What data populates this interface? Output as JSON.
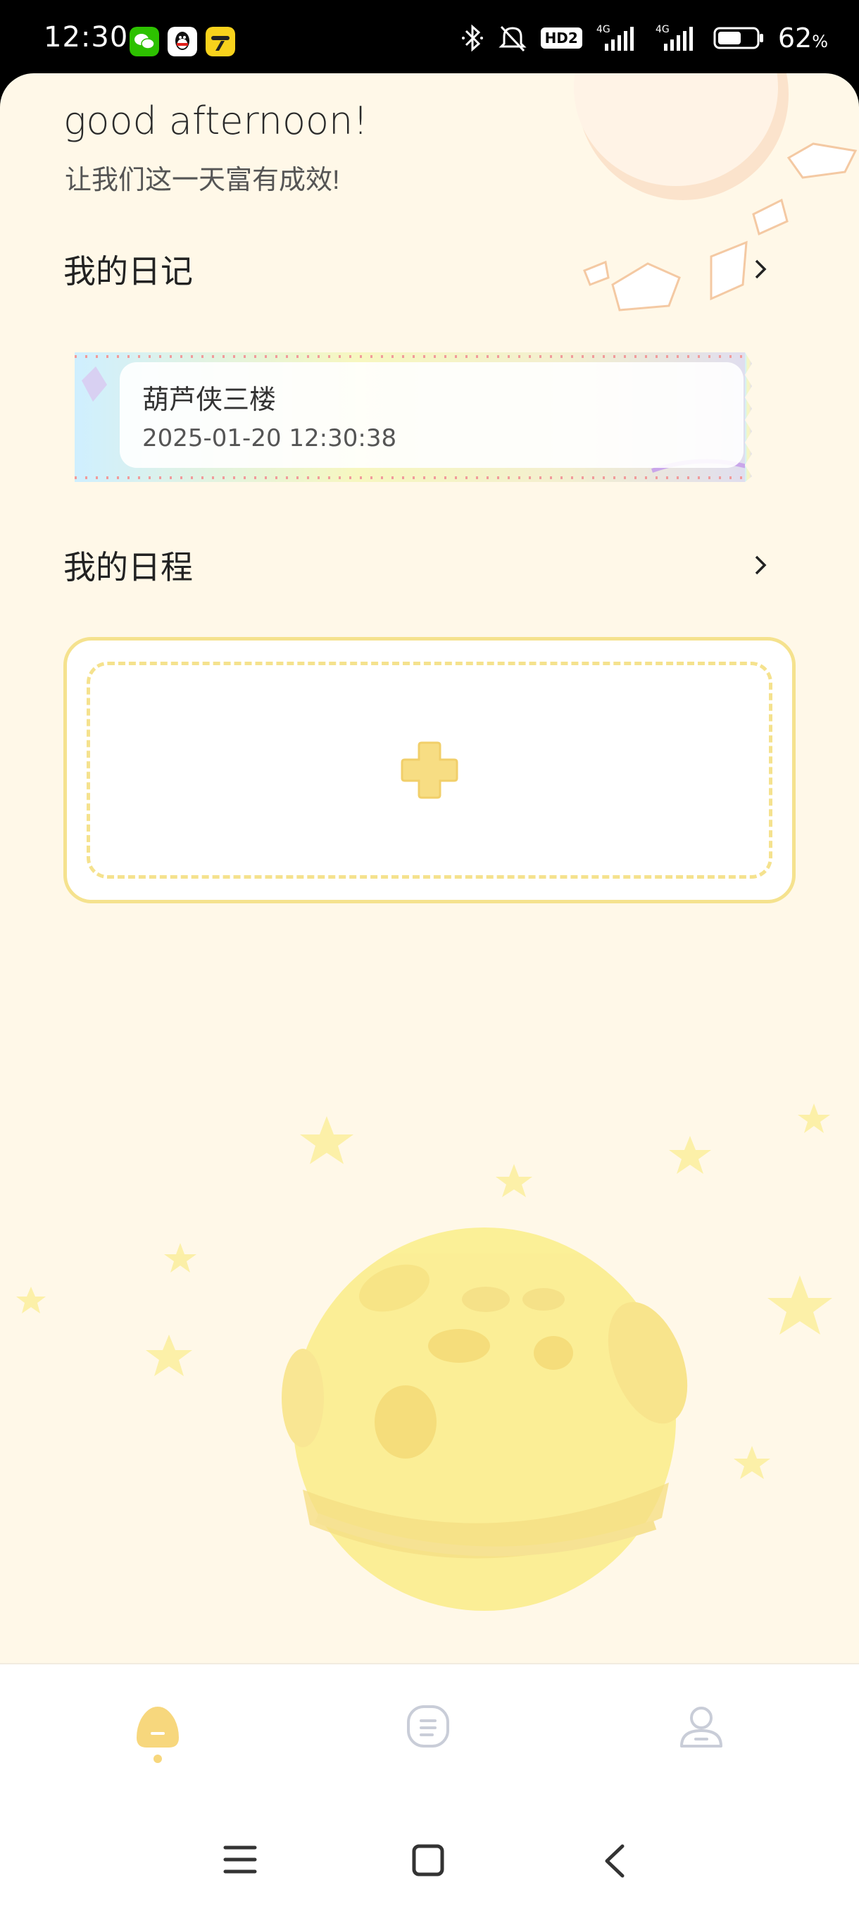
{
  "status_bar": {
    "time": "12:30",
    "network_badge": "HD2",
    "signal_1": "4G",
    "signal_2": "4G",
    "battery_percent": "62",
    "battery_unit": "%",
    "battery_level": 0.62,
    "notification_icons": [
      "wechat-icon",
      "qq-icon",
      "duck-app-icon"
    ],
    "system_icons": [
      "bluetooth-icon",
      "mute-icon",
      "signal-icon",
      "battery-icon"
    ]
  },
  "header": {
    "greeting": "good afternoon!",
    "subtitle": "让我们这一天富有成效!"
  },
  "diary_section": {
    "title": "我的日记",
    "entries": [
      {
        "title": "葫芦侠三楼",
        "timestamp": "2025-01-20 12:30:38"
      }
    ]
  },
  "schedule_section": {
    "title": "我的日程",
    "add_icon": "plus-icon"
  },
  "tabbar": {
    "active_index": 0,
    "tabs": [
      {
        "icon": "home-icon"
      },
      {
        "icon": "notes-icon"
      },
      {
        "icon": "profile-icon"
      }
    ]
  },
  "system_nav": [
    "menu-icon",
    "home-square-icon",
    "back-icon"
  ],
  "colors": {
    "background": "#fff8e8",
    "accent": "#f7d77d",
    "card_border": "#f5e28e",
    "inactive_icon": "#c9cdd8"
  }
}
